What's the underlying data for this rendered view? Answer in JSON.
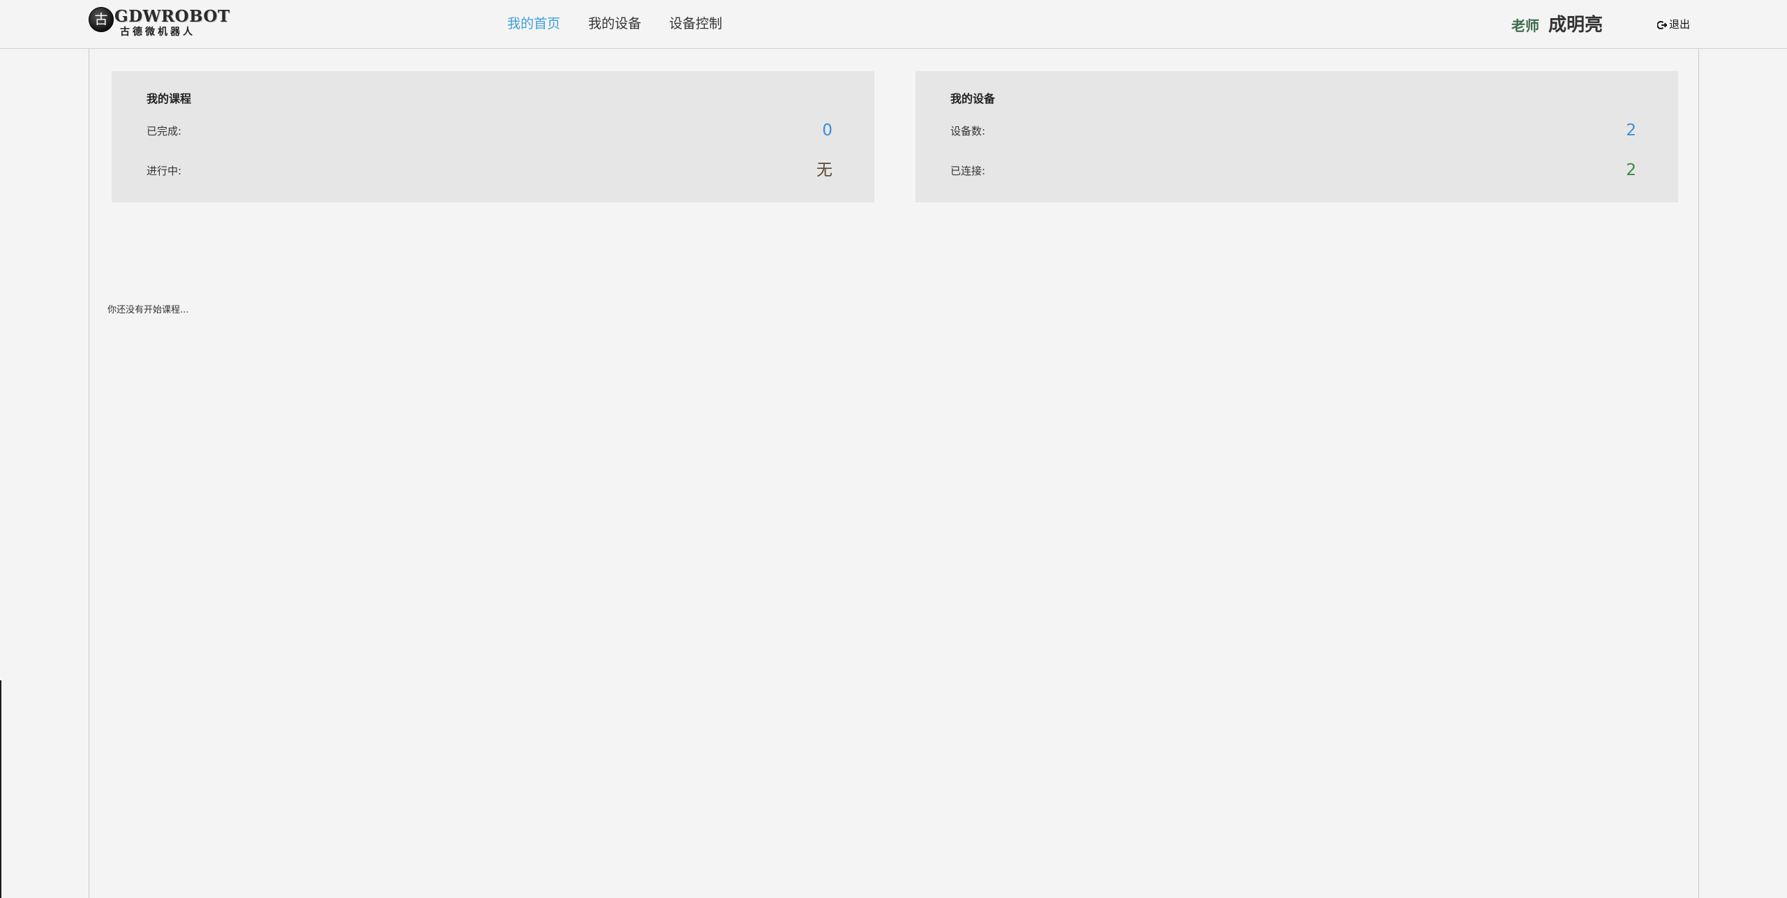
{
  "brand": {
    "emblem_char": "古",
    "name": "GDWROBOT",
    "subtitle": "古德微机器人"
  },
  "nav": {
    "items": [
      {
        "label": "我的首页",
        "active": true
      },
      {
        "label": "我的设备",
        "active": false
      },
      {
        "label": "设备控制",
        "active": false
      }
    ]
  },
  "user": {
    "role": "老师",
    "name": "成明亮",
    "logout_label": "退出",
    "logout_icon": "sign-out-icon"
  },
  "courses": {
    "title": "我的课程",
    "completed_label": "已完成:",
    "completed_value": "0",
    "in_progress_label": "进行中:",
    "in_progress_value": "无"
  },
  "devices": {
    "title": "我的设备",
    "count_label": "设备数:",
    "count_value": "2",
    "connected_label": "已连接:",
    "connected_value": "2"
  },
  "empty_message": "你还没有开始课程...",
  "colors": {
    "nav_active": "#3fa0d8",
    "value_blue": "#3b8fd6",
    "value_brown": "#5a4a33",
    "value_green": "#3a8a3f",
    "role_green": "#3b6b4d"
  }
}
